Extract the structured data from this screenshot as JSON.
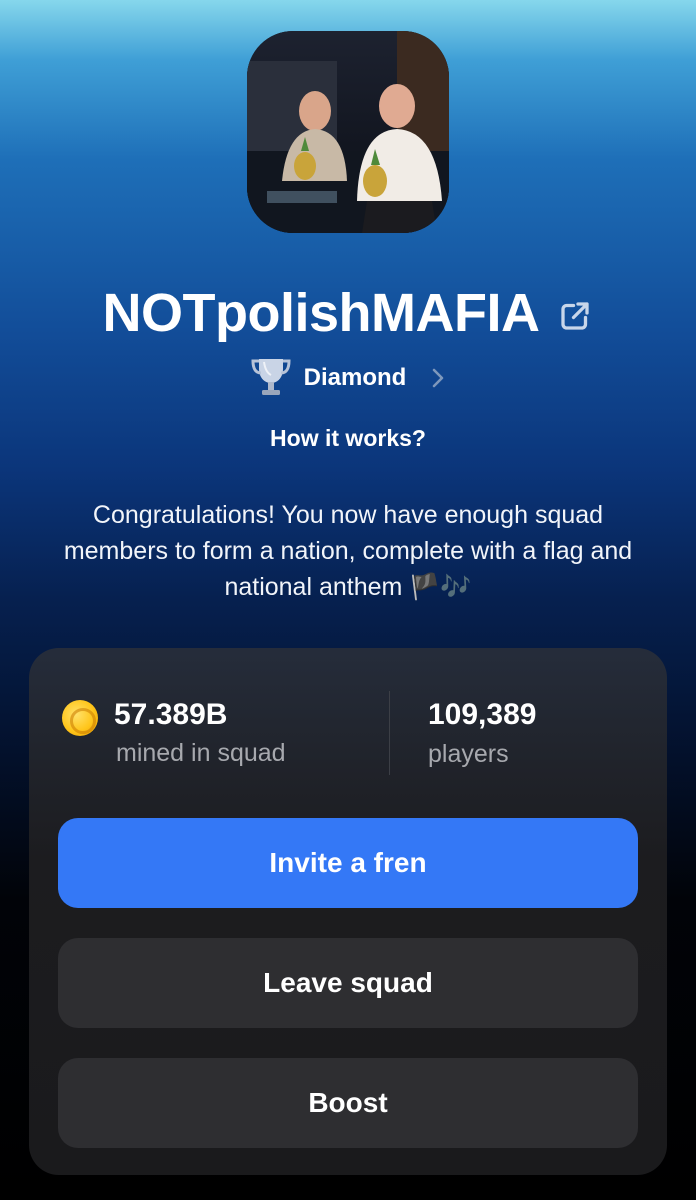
{
  "squad": {
    "name": "NOTpolishMAFIA",
    "avatar_icon": "squad-avatar-photo",
    "external_link_icon": "external-link-icon"
  },
  "league": {
    "icon": "trophy-icon",
    "label": "Diamond"
  },
  "how_it_works": "How it works?",
  "message": "Congratulations! You now have enough squad members to form a nation, complete with a flag and national anthem 🏴🎶",
  "stats": {
    "mined_value": "57.389B",
    "mined_label": "mined in squad",
    "players_value": "109,389",
    "players_label": "players"
  },
  "buttons": {
    "invite": "Invite a fren",
    "leave": "Leave squad",
    "boost": "Boost"
  },
  "colors": {
    "primary_button": "#3478f6",
    "secondary_button": "#2e2e31",
    "coin": "#ffc51a"
  }
}
